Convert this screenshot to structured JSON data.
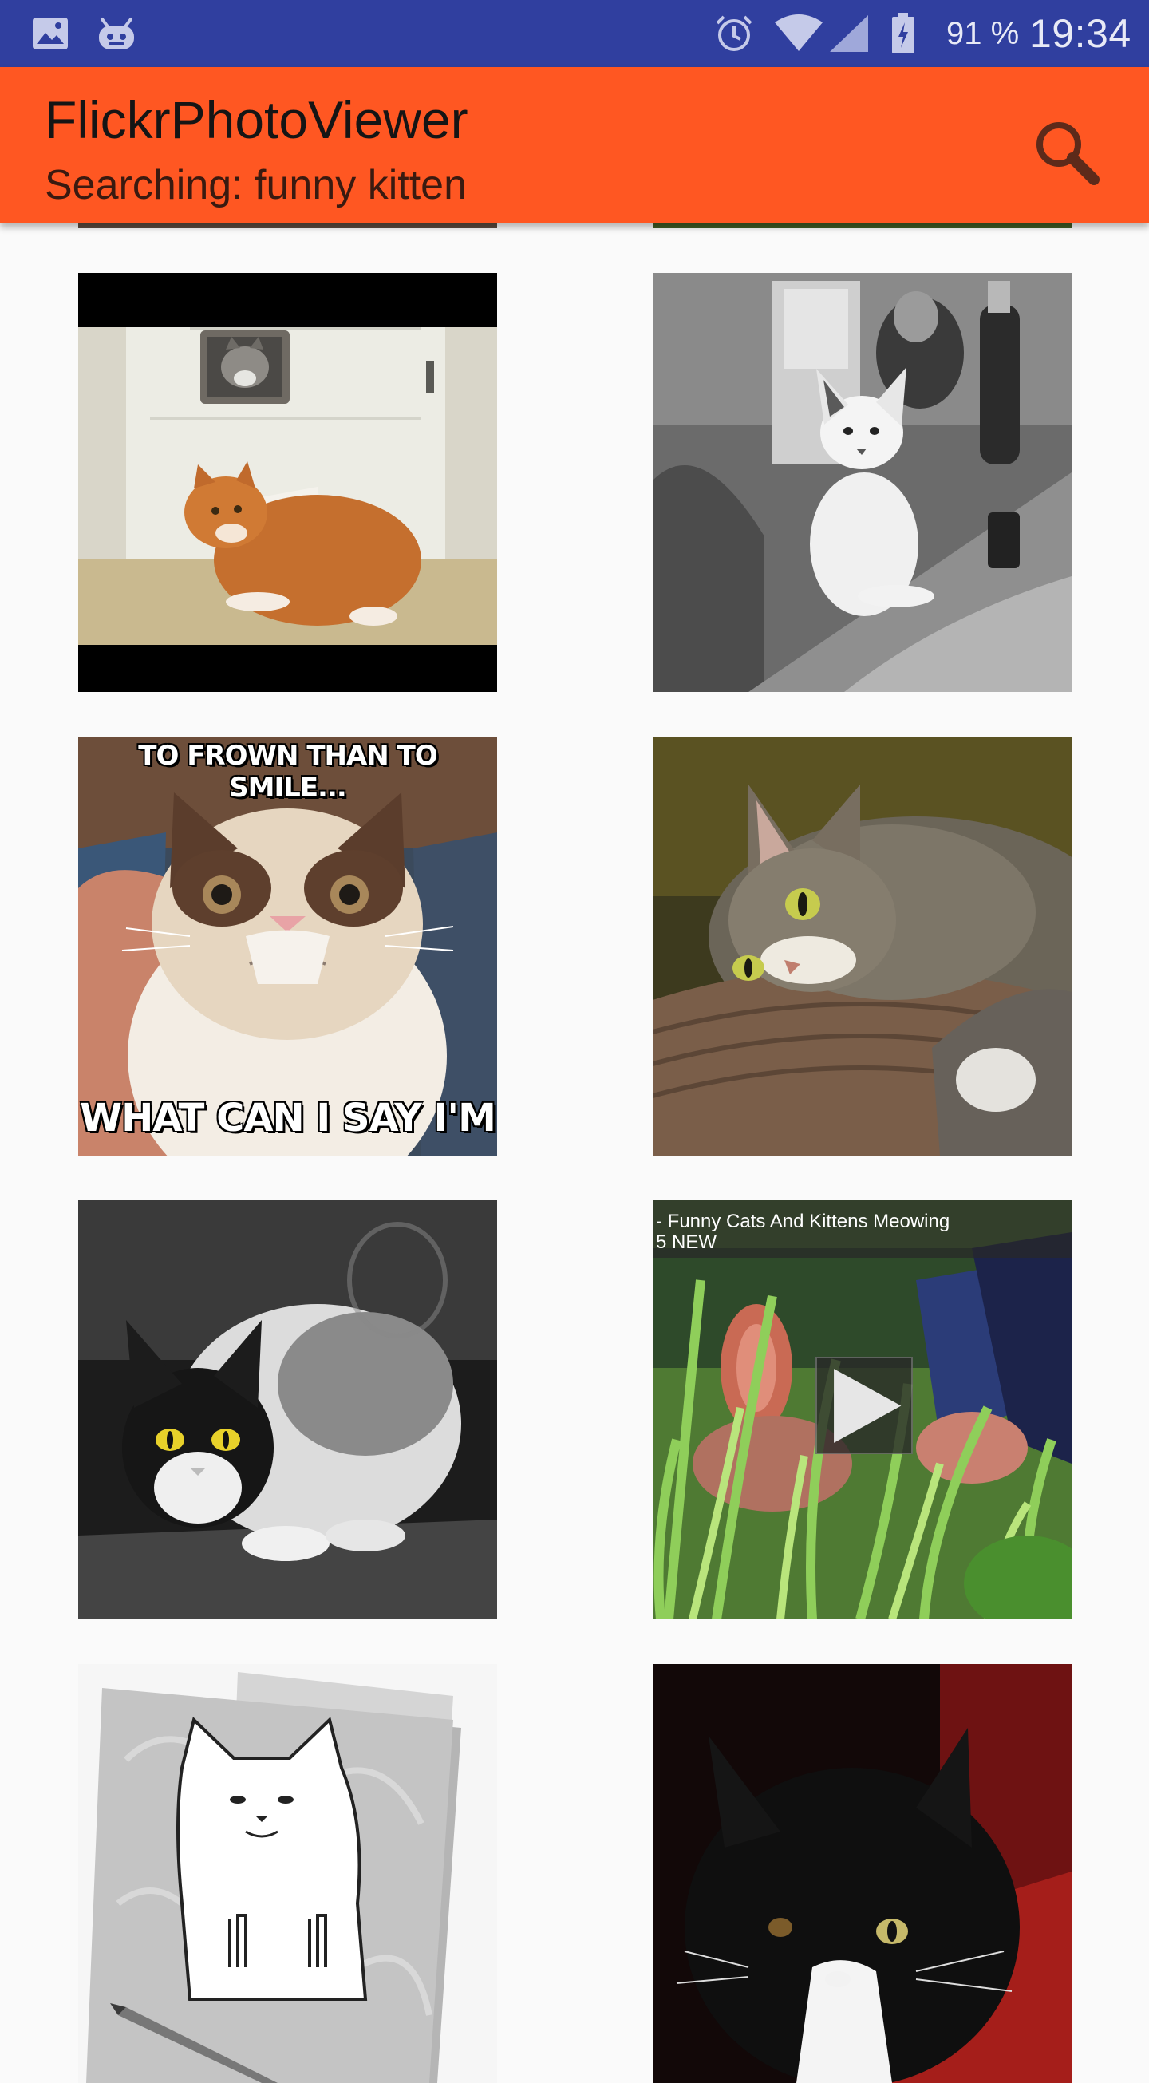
{
  "status_bar": {
    "battery_percent": "91 %",
    "time": "19:34",
    "icons": [
      "image-icon",
      "android-icon",
      "alarm-icon",
      "wifi-icon",
      "signal-icon",
      "battery-icon"
    ]
  },
  "app_bar": {
    "title": "FlickrPhotoViewer",
    "subtitle": "Searching: funny kitten",
    "background": "#ff5722",
    "search_icon": "search-icon"
  },
  "photos": [
    {
      "description": "kitten-in-door"
    },
    {
      "description": "bw-kitten-table"
    },
    {
      "description": "grumpy-cat-meme",
      "top_text": "TO FROWN THAN TO SMILE...",
      "bottom_text": "WHAT CAN I SAY I'M"
    },
    {
      "description": "tabby-cat-lying"
    },
    {
      "description": "bw-cat-yellow-eyes"
    },
    {
      "description": "video-kitten-grass",
      "video_title": "- Funny Cats And Kittens Meowing\n5 NEW"
    },
    {
      "description": "cat-sticker-notebook"
    },
    {
      "description": "black-white-cat-red"
    }
  ],
  "colors": {
    "status_bar": "#303f9f",
    "app_bar": "#ff5722",
    "background": "#fafafa"
  }
}
